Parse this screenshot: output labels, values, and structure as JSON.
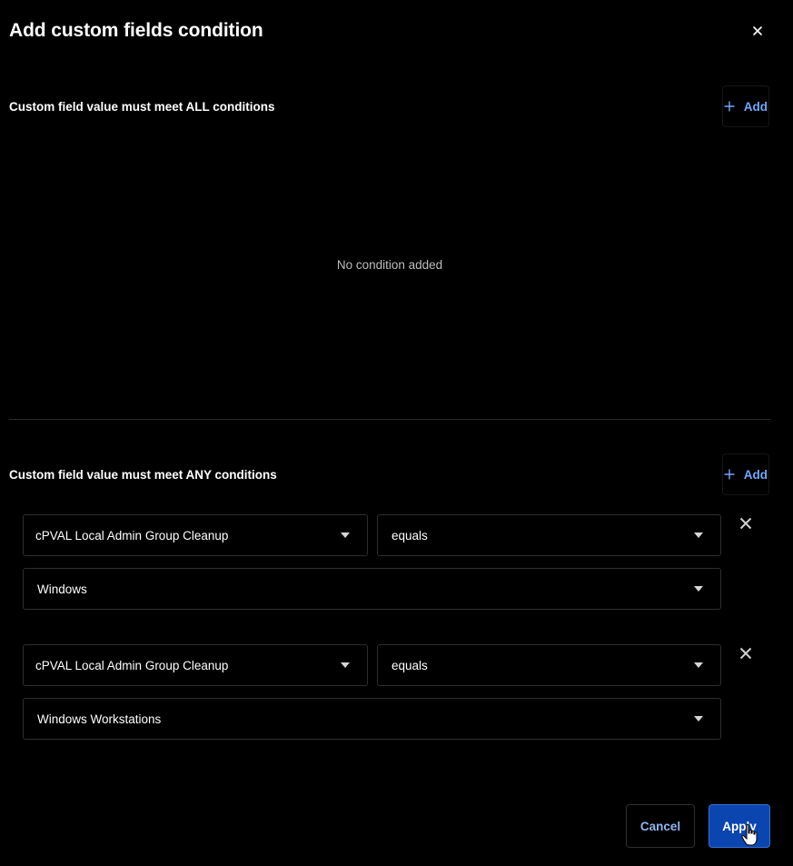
{
  "dialog": {
    "title": "Add custom fields condition",
    "close_icon": "close-icon"
  },
  "all_section": {
    "label": "Custom field value must meet ALL conditions",
    "add_label": "Add",
    "empty_message": "No condition added"
  },
  "any_section": {
    "label": "Custom field value must meet ANY conditions",
    "add_label": "Add",
    "conditions": [
      {
        "field": "cPVAL Local Admin Group Cleanup",
        "operator": "equals",
        "value": "Windows"
      },
      {
        "field": "cPVAL Local Admin Group Cleanup",
        "operator": "equals",
        "value": "Windows Workstations"
      }
    ]
  },
  "footer": {
    "cancel_label": "Cancel",
    "apply_label": "Apply"
  },
  "colors": {
    "background": "#000000",
    "accent": "#6fa8ff",
    "apply_button": "#0a45b0"
  }
}
